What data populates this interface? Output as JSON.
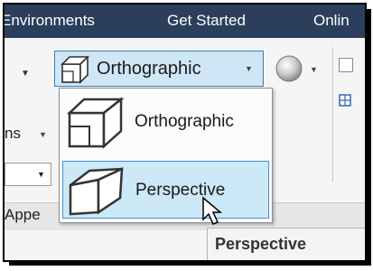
{
  "tabs": {
    "environments": "Environments",
    "get_started": "Get Started",
    "online": "Onlin"
  },
  "ribbon": {
    "view_mode_button": {
      "label": "Orthographic",
      "icon": "orthographic-cube-icon"
    },
    "visual_style_icon": "sphere-icon",
    "left_label_fragment": "ns",
    "panel_label_fragment": "Appe"
  },
  "menu": {
    "items": [
      {
        "label": "Orthographic",
        "icon": "orthographic-cube-icon",
        "highlighted": false
      },
      {
        "label": "Perspective",
        "icon": "perspective-cube-icon",
        "highlighted": true
      }
    ]
  },
  "tooltip": {
    "text": "Perspective"
  },
  "colors": {
    "tab_bar": "#2b3f5c",
    "highlight_fill": "#cde8f7",
    "highlight_border": "#3e94d1"
  }
}
